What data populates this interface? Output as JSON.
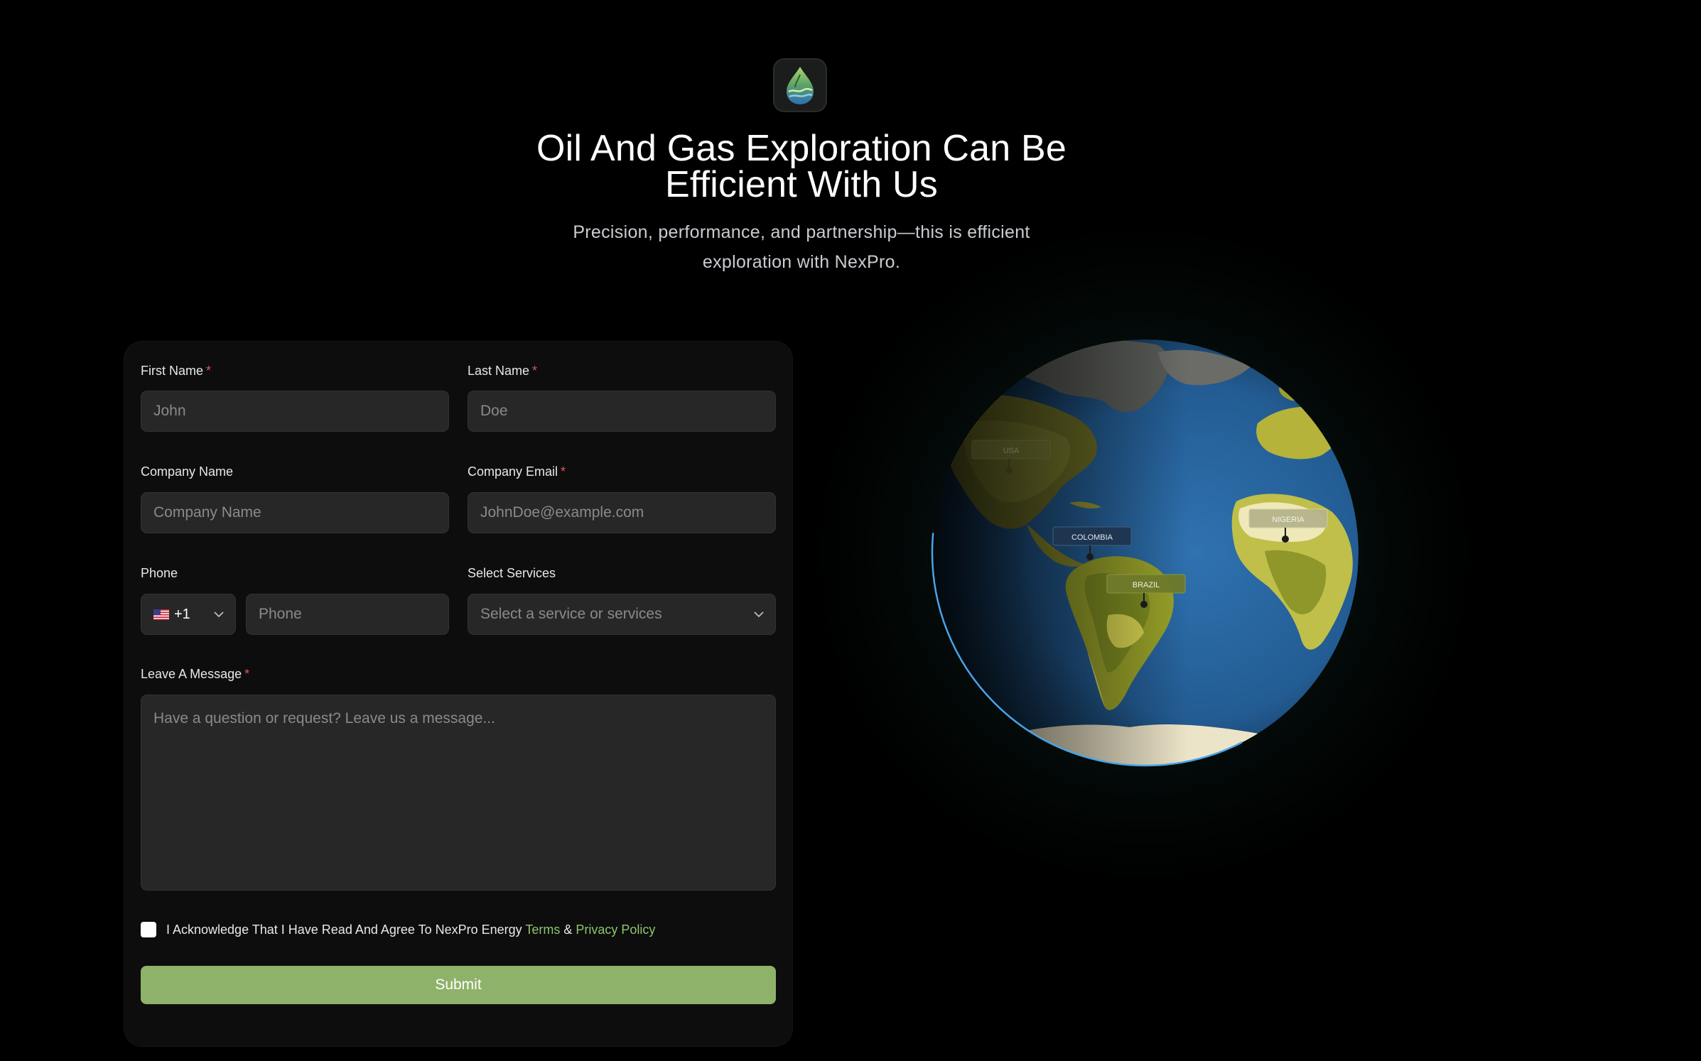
{
  "hero": {
    "title_line1": "Oil And Gas Exploration Can Be",
    "title_line2": "Efficient With Us",
    "subtitle_line1": "Precision, performance, and partnership—this is efficient",
    "subtitle_line2": "exploration with NexPro."
  },
  "form": {
    "first_name": {
      "label": "First Name",
      "required": "*",
      "placeholder": "John"
    },
    "last_name": {
      "label": "Last Name",
      "required": "*",
      "placeholder": "Doe"
    },
    "company_name": {
      "label": "Company Name",
      "placeholder": "Company Name"
    },
    "company_email": {
      "label": "Company Email",
      "required": "*",
      "placeholder": "JohnDoe@example.com"
    },
    "phone": {
      "label": "Phone",
      "country_code": "+1",
      "placeholder": "Phone"
    },
    "services": {
      "label": "Select Services",
      "placeholder": "Select a service or services"
    },
    "message": {
      "label": "Leave A Message",
      "required": "*",
      "placeholder": "Have a question or request? Leave us a message..."
    },
    "acknowledge": {
      "text": "I Acknowledge That I Have Read And Agree To NexPro Energy",
      "terms": "Terms",
      "amp": "&",
      "privacy": "Privacy Policy"
    },
    "submit_label": "Submit"
  },
  "globe": {
    "markers": [
      {
        "label": "USA"
      },
      {
        "label": "COLOMBIA"
      },
      {
        "label": "BRAZIL"
      },
      {
        "label": "NIGERIA"
      }
    ]
  },
  "colors": {
    "accent": "#8eb269",
    "link": "#8cc56b",
    "required": "#e05555",
    "ocean": "#2a66a0"
  }
}
